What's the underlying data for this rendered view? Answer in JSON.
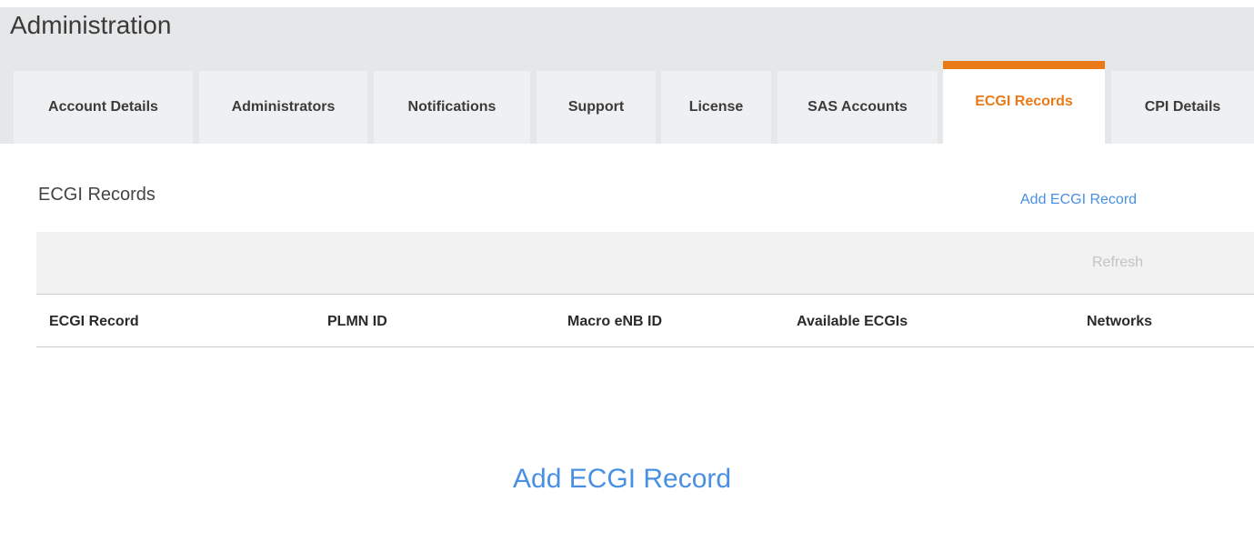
{
  "page": {
    "title": "Administration"
  },
  "tabs": [
    {
      "label": "Account Details",
      "active": false
    },
    {
      "label": "Administrators",
      "active": false
    },
    {
      "label": "Notifications",
      "active": false
    },
    {
      "label": "Support",
      "active": false
    },
    {
      "label": "License",
      "active": false
    },
    {
      "label": "SAS Accounts",
      "active": false
    },
    {
      "label": "ECGI Records",
      "active": true
    },
    {
      "label": "CPI Details",
      "active": false
    }
  ],
  "section": {
    "title": "ECGI Records",
    "add_link": "Add ECGI Record"
  },
  "toolbar": {
    "refresh_label": "Refresh"
  },
  "table": {
    "columns": [
      "ECGI Record",
      "PLMN ID",
      "Macro eNB ID",
      "Available ECGIs",
      "Networks"
    ]
  },
  "empty_state": {
    "cta_label": "Add ECGI Record"
  },
  "colors": {
    "accent": "#ea7a18",
    "link": "#4a90e2",
    "header_bg": "#e6e7e8",
    "tab_bg": "#eff0f1",
    "toolbar_bg": "#f2f2f2"
  }
}
